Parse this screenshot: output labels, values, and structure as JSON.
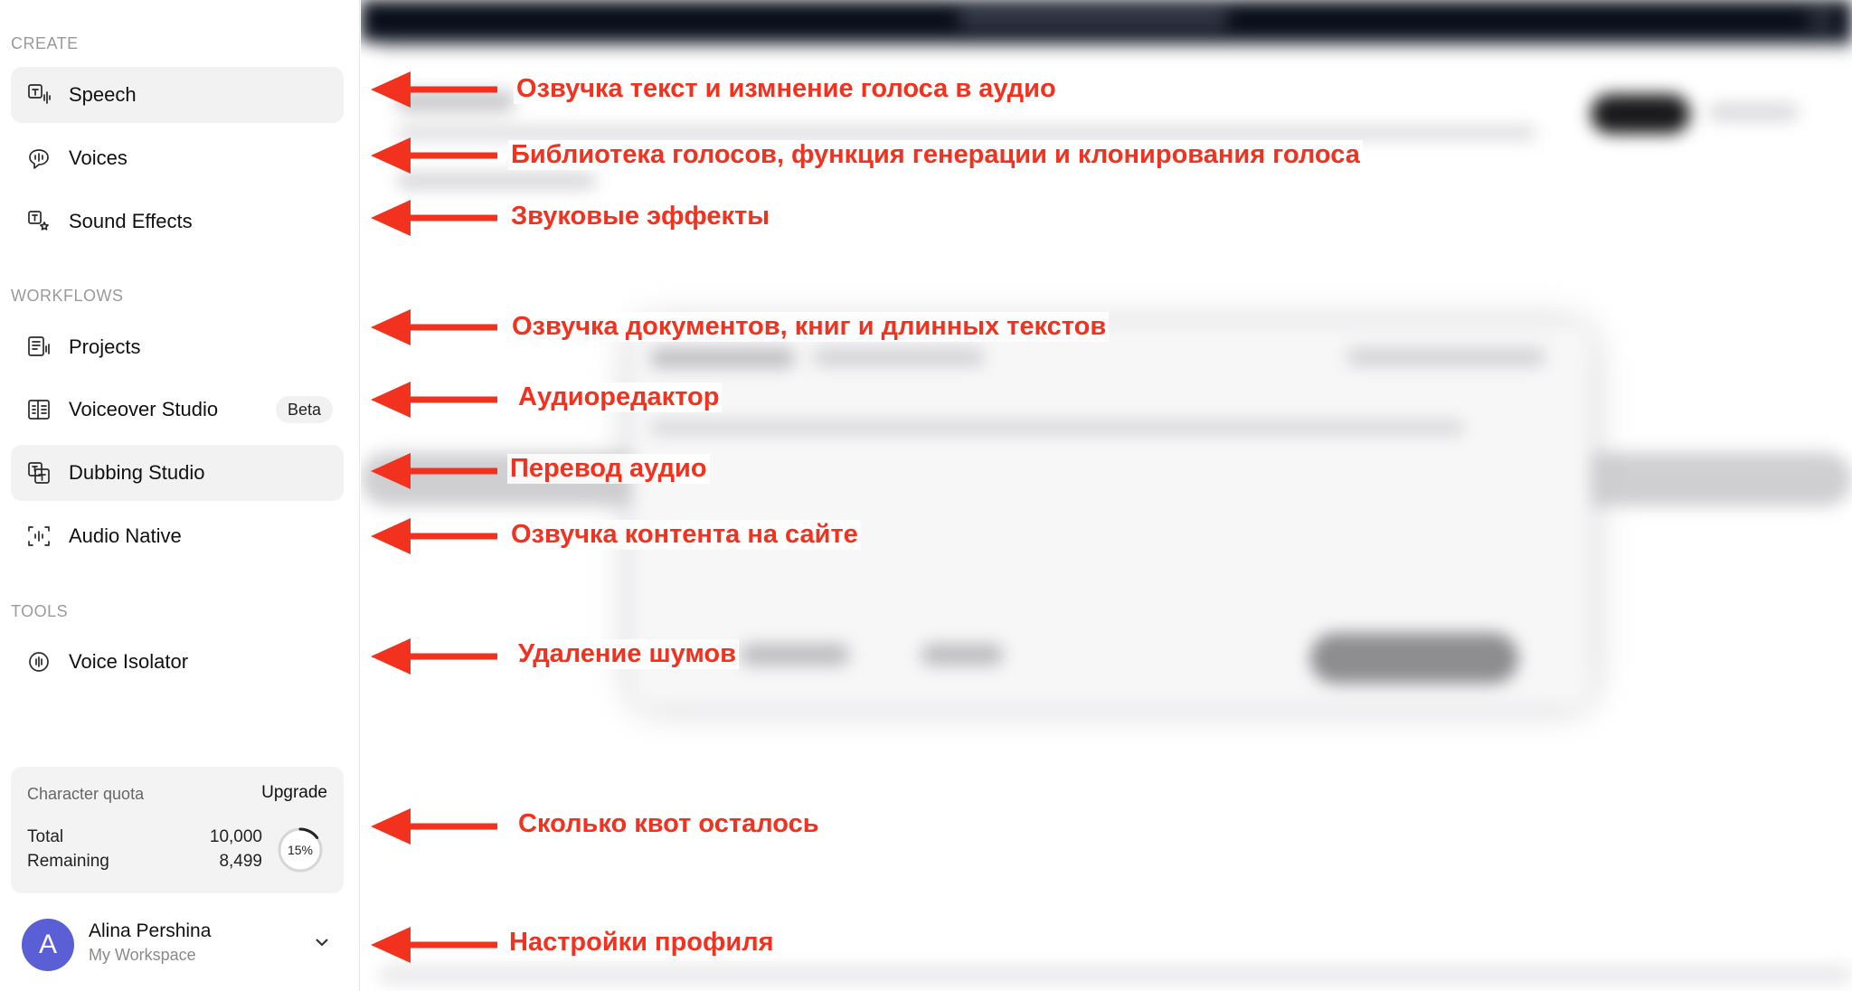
{
  "sidebar": {
    "sections": {
      "create": "CREATE",
      "workflows": "WORKFLOWS",
      "tools": "TOOLS"
    },
    "items": {
      "speech": "Speech",
      "voices": "Voices",
      "sound_effects": "Sound Effects",
      "projects": "Projects",
      "voiceover_studio": "Voiceover Studio",
      "voiceover_badge": "Beta",
      "dubbing_studio": "Dubbing Studio",
      "audio_native": "Audio Native",
      "voice_isolator": "Voice Isolator"
    },
    "quota": {
      "title": "Character quota",
      "upgrade": "Upgrade",
      "total_label": "Total",
      "total_value": "10,000",
      "remaining_label": "Remaining",
      "remaining_value": "8,499",
      "percent_label": "15%",
      "percent_used": 0.15
    },
    "profile": {
      "initial": "A",
      "name": "Alina Pershina",
      "workspace": "My Workspace"
    }
  },
  "annotations": {
    "speech": "Озвучка текст и измнение голоса в аудио",
    "voices": "Библиотека голосов, функция генерации и клонирования голоса",
    "sound_effects": "Звуковые эффекты",
    "projects": "Озвучка документов, книг и длинных текстов",
    "voiceover": "Аудиоредактор",
    "dubbing": "Перевод аудио",
    "audio_native": "Озвучка контента на сайте",
    "isolator": "Удаление шумов",
    "quota": "Сколько квот осталось",
    "profile": "Настройки профиля"
  },
  "colors": {
    "annotation": "#f2311e",
    "avatar": "#5b5fd6",
    "topbar": "#0b0f1c"
  }
}
